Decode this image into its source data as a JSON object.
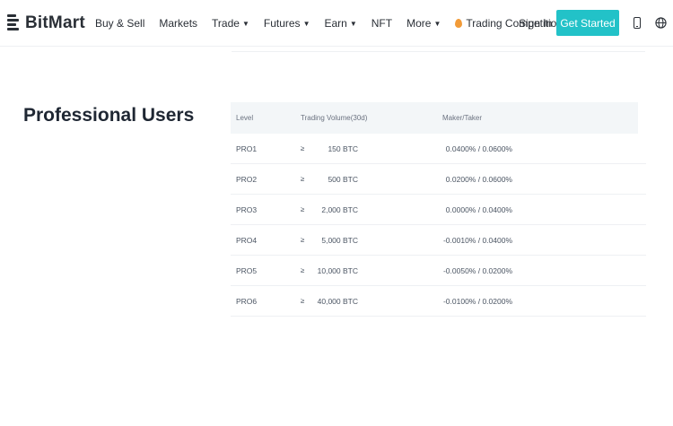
{
  "header": {
    "logo_text": "BitMart",
    "nav": [
      {
        "label": "Buy & Sell",
        "caret": false
      },
      {
        "label": "Markets",
        "caret": false
      },
      {
        "label": "Trade",
        "caret": true
      },
      {
        "label": "Futures",
        "caret": true
      },
      {
        "label": "Earn",
        "caret": true
      },
      {
        "label": "NFT",
        "caret": false
      },
      {
        "label": "More",
        "caret": true
      },
      {
        "label": "Trading Competition",
        "caret": false
      }
    ],
    "signin_label": "Sign In",
    "get_started_label": "Get Started",
    "accent_color": "#22c2c8"
  },
  "section": {
    "title": "Professional Users",
    "columns": [
      "Level",
      "Trading Volume(30d)",
      "Maker/Taker"
    ],
    "rows": [
      {
        "level": "PRO1",
        "volume": "150 BTC",
        "fee": "0.0400% / 0.0600%"
      },
      {
        "level": "PRO2",
        "volume": "500 BTC",
        "fee": "0.0200% / 0.0600%"
      },
      {
        "level": "PRO3",
        "volume": "2,000 BTC",
        "fee": "0.0000% / 0.0400%"
      },
      {
        "level": "PRO4",
        "volume": "5,000 BTC",
        "fee": "-0.0010% / 0.0400%"
      },
      {
        "level": "PRO5",
        "volume": "10,000 BTC",
        "fee": "-0.0050% / 0.0200%"
      },
      {
        "level": "PRO6",
        "volume": "40,000 BTC",
        "fee": "-0.0100% / 0.0200%"
      }
    ],
    "ge_symbol": "≥"
  }
}
